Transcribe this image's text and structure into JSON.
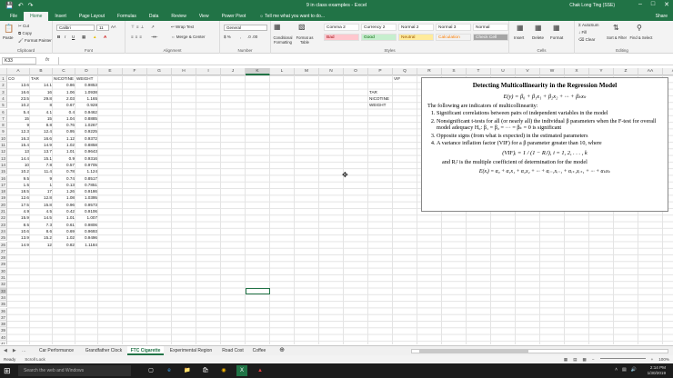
{
  "titlebar": {
    "doc_title": "9 in class examples - Excel",
    "user": "Chak Long Ting (SSE)",
    "colors": {
      "excel_green": "#217346"
    }
  },
  "ribbon_tabs": [
    "File",
    "Home",
    "Insert",
    "Page Layout",
    "Formulas",
    "Data",
    "Review",
    "View",
    "Power Pivot"
  ],
  "active_tab": "Home",
  "tell_me": "Tell me what you want to do...",
  "share": "Share",
  "ribbon": {
    "clipboard": {
      "paste": "Paste",
      "cut": "Cut",
      "copy": "Copy",
      "format_painter": "Format Painter",
      "label": "Clipboard"
    },
    "font": {
      "name": "Calibri",
      "size": "11",
      "label": "Font"
    },
    "alignment": {
      "wrap_text": "Wrap Text",
      "merge_center": "Merge & Center",
      "label": "Alignment"
    },
    "number": {
      "format": "General",
      "label": "Number"
    },
    "styles": {
      "conditional": "Conditional Formatting",
      "format_table": "Format as Table",
      "cells": [
        {
          "name": "Comma 2",
          "bg": "#ffffff",
          "fg": "#222222"
        },
        {
          "name": "Currency 2",
          "bg": "#ffffff",
          "fg": "#222222"
        },
        {
          "name": "Normal 2",
          "bg": "#ffffff",
          "fg": "#222222"
        },
        {
          "name": "Normal 3",
          "bg": "#ffffff",
          "fg": "#222222"
        },
        {
          "name": "Normal",
          "bg": "#ffffff",
          "fg": "#222222"
        },
        {
          "name": "Bad",
          "bg": "#ffc7ce",
          "fg": "#9c0006"
        },
        {
          "name": "Good",
          "bg": "#c6efce",
          "fg": "#006100"
        },
        {
          "name": "Neutral",
          "bg": "#ffeb9c",
          "fg": "#9c5700"
        },
        {
          "name": "Calculation",
          "bg": "#f2f2f2",
          "fg": "#fa7d00"
        },
        {
          "name": "Check Cell",
          "bg": "#a5a5a5",
          "fg": "#ffffff"
        }
      ],
      "label": "Styles"
    },
    "cells": {
      "insert": "Insert",
      "delete": "Delete",
      "format": "Format",
      "label": "Cells"
    },
    "editing": {
      "autosum": "AutoSum",
      "fill": "Fill",
      "clear": "Clear",
      "sort_filter": "Sort & Filter",
      "find_select": "Find & Select",
      "label": "Editing"
    }
  },
  "formula_bar": {
    "name_box": "K33",
    "fx": "fx",
    "content": ""
  },
  "columns": [
    "A",
    "B",
    "C",
    "D",
    "E",
    "F",
    "G",
    "H",
    "I",
    "J",
    "K",
    "L",
    "M",
    "N",
    "O",
    "P",
    "Q",
    "R",
    "S",
    "T",
    "U",
    "V",
    "W",
    "X",
    "Y",
    "Z",
    "AA",
    "AB"
  ],
  "headers": [
    "CO",
    "TAR",
    "NICOTINE",
    "WEIGHT"
  ],
  "rows": [
    [
      "13.6",
      "14.1",
      "0.86",
      "0.9853"
    ],
    [
      "16.6",
      "16",
      "1.06",
      "1.0938"
    ],
    [
      "23.5",
      "29.8",
      "2.03",
      "1.165"
    ],
    [
      "10.2",
      "8",
      "0.67",
      "0.928"
    ],
    [
      "5.4",
      "4.1",
      "0.4",
      "0.9462"
    ],
    [
      "15",
      "15",
      "1.04",
      "0.8885"
    ],
    [
      "9",
      "8.8",
      "0.76",
      "1.0267"
    ],
    [
      "12.3",
      "12.4",
      "0.95",
      "0.9225"
    ],
    [
      "16.3",
      "16.6",
      "1.12",
      "0.9372"
    ],
    [
      "15.4",
      "14.9",
      "1.02",
      "0.8858"
    ],
    [
      "13",
      "13.7",
      "1.01",
      "0.9643"
    ],
    [
      "14.4",
      "15.1",
      "0.9",
      "0.9316"
    ],
    [
      "10",
      "7.8",
      "0.57",
      "0.9705"
    ],
    [
      "10.2",
      "11.4",
      "0.78",
      "1.124"
    ],
    [
      "9.5",
      "9",
      "0.74",
      "0.8517"
    ],
    [
      "1.5",
      "1",
      "0.13",
      "0.7851"
    ],
    [
      "18.5",
      "17",
      "1.26",
      "0.9186"
    ],
    [
      "12.6",
      "12.8",
      "1.08",
      "1.0395"
    ],
    [
      "17.5",
      "15.8",
      "0.96",
      "0.9573"
    ],
    [
      "4.9",
      "4.5",
      "0.42",
      "0.9106"
    ],
    [
      "15.9",
      "14.5",
      "1.01",
      "1.007"
    ],
    [
      "8.5",
      "7.3",
      "0.61",
      "0.9806"
    ],
    [
      "10.6",
      "8.6",
      "0.69",
      "0.9693"
    ],
    [
      "13.9",
      "15.2",
      "1.02",
      "0.9496"
    ],
    [
      "14.9",
      "12",
      "0.82",
      "1.1184"
    ]
  ],
  "row_numbers": [
    "1",
    "2",
    "3",
    "4",
    "5",
    "6",
    "7",
    "8",
    "9",
    "10",
    "11",
    "12",
    "13",
    "14",
    "15",
    "16",
    "17",
    "18",
    "19",
    "20",
    "21",
    "22",
    "23",
    "24",
    "25",
    "26",
    "27",
    "28",
    "29",
    "30",
    "31",
    "32",
    "33",
    "34",
    "35",
    "36",
    "37",
    "38",
    "39",
    "40",
    "41"
  ],
  "vif_table": {
    "header": "VIF",
    "labels": [
      "TAR",
      "NICOTINE",
      "WEIGHT"
    ]
  },
  "textbox": {
    "title": "Detecting Multicollinearity in the Regression Model",
    "model": "E(y) = β₀ + β₁x₁ + β₂x₂ + ··· + βₖxₖ",
    "intro": "The following are indicators of multicollinearity:",
    "items": [
      "Significant correlations between pairs of independent variables in the model",
      "Nonsignificant t-tests for all (or nearly all) the individual β parameters when the F-test for overall model adequacy H₀: β₁ = β₂ = ··· = βₖ = 0 is significant",
      "Opposite signs (from what is expected) in the estimated parameters",
      "A variance inflation factor (VIF) for a β parameter greater than 10, where"
    ],
    "vif_formula": "(VIF)ᵢ = 1 / (1 − Rᵢ²),   i = 1, 2, . . . , k",
    "r2_note": "and Rᵢ² is the multiple coefficient of determination for the model",
    "aux_model": "E(xᵢ) = α₀ + α₁x₁ + α₂x₂ + ··· + αᵢ₋₁xᵢ₋₁ + αᵢ₊₁xᵢ₊₁ + ··· + αₖxₖ"
  },
  "sheets": [
    "Car Performance",
    "Grandfather Clock",
    "FTC Cigarette",
    "Experimental Region",
    "Road Cost",
    "Coffee"
  ],
  "active_sheet": "FTC Cigarette",
  "status": {
    "ready": "Ready",
    "scroll_lock": "Scroll Lock",
    "zoom": "100%"
  },
  "taskbar": {
    "search": "Search the web and Windows",
    "time": "2:14 PM",
    "date": "1/30/2019"
  }
}
